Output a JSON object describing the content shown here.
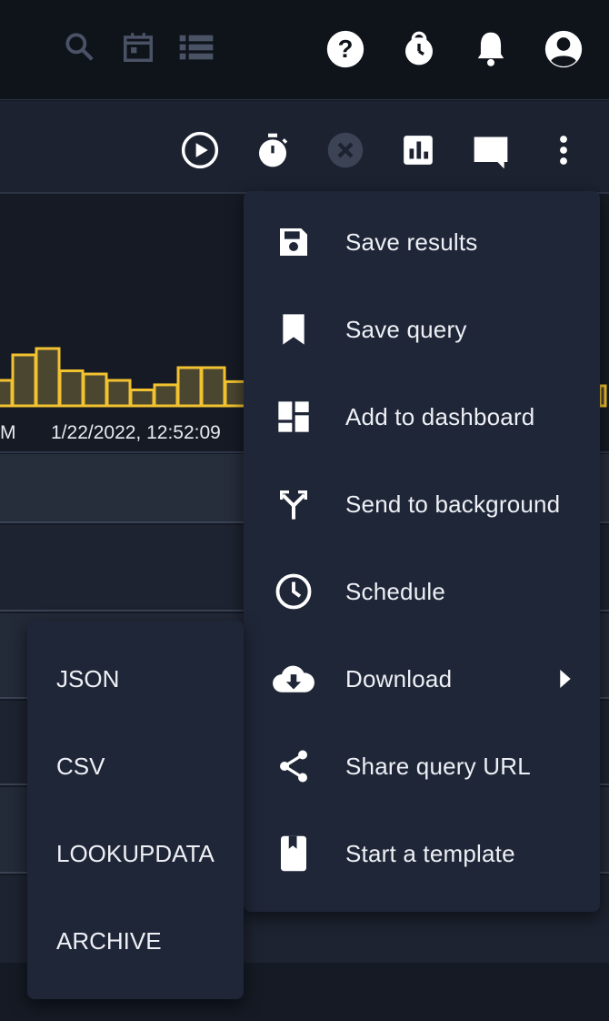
{
  "topbar": {
    "icons": [
      "search-icon",
      "calendar-icon",
      "list-icon",
      "help-icon",
      "timer-alert-icon",
      "bell-icon",
      "account-icon"
    ]
  },
  "toolbar": {
    "icons": [
      "run-icon",
      "stopwatch-icon",
      "cancel-icon",
      "chart-icon",
      "comment-icon",
      "more-vertical-icon"
    ]
  },
  "chart": {
    "bar_color": "#f2c230",
    "bar_fill": "#4a4630",
    "heights": [
      0.4,
      0.8,
      0.9,
      0.55,
      0.5,
      0.4,
      0.25,
      0.33,
      0.6,
      0.6,
      0.38
    ]
  },
  "timeline": {
    "left_fragment": "M",
    "timestamp": "1/22/2022, 12:52:09"
  },
  "menu": {
    "items": [
      {
        "label": "Save results",
        "icon": "save-icon"
      },
      {
        "label": "Save query",
        "icon": "bookmark-icon"
      },
      {
        "label": "Add to dashboard",
        "icon": "dashboard-icon"
      },
      {
        "label": "Send to background",
        "icon": "fork-icon"
      },
      {
        "label": "Schedule",
        "icon": "clock-icon"
      },
      {
        "label": "Download",
        "icon": "cloud-download-icon",
        "has_submenu": true
      },
      {
        "label": "Share query URL",
        "icon": "share-icon"
      },
      {
        "label": "Start a template",
        "icon": "template-icon"
      }
    ]
  },
  "download_submenu": {
    "items": [
      "JSON",
      "CSV",
      "LOOKUPDATA",
      "ARCHIVE"
    ]
  }
}
